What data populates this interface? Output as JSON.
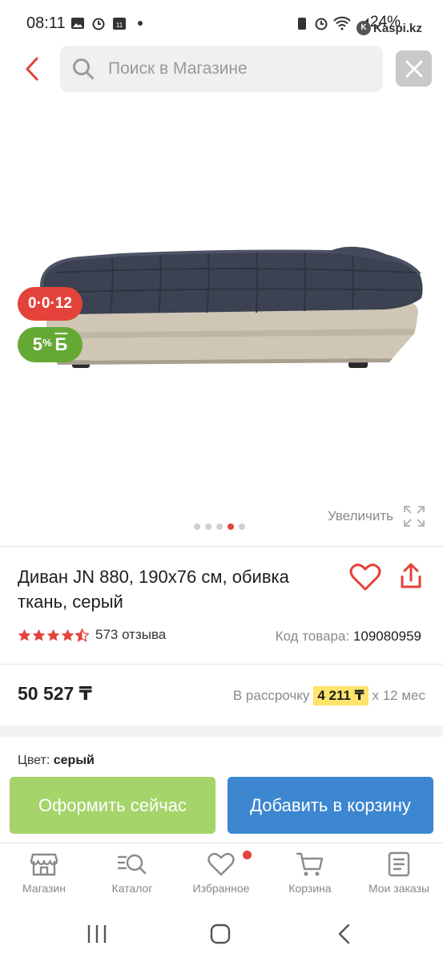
{
  "status_bar": {
    "time": "08:11",
    "battery": "24%",
    "watermark": "Kaspi.kz",
    "icons_left": [
      "gallery-icon",
      "alarm-icon",
      "calendar-icon",
      "dot-icon"
    ],
    "icons_right": [
      "battery-saver-icon",
      "alarm-icon",
      "wifi-icon",
      "signal-icon"
    ]
  },
  "search": {
    "placeholder": "Поиск в Магазине"
  },
  "gallery": {
    "badge_installment": "0·0·12",
    "badge_bonus_percent": "5",
    "badge_bonus_suffix": "%",
    "badge_bonus_currency": "Б",
    "zoom_label": "Увеличить",
    "image_count": 5,
    "active_image_index": 3
  },
  "product": {
    "title": "Диван JN 880, 190x76 см, обивка ткань, серый",
    "rating": 4.5,
    "reviews": "573 отзыва",
    "sku_label": "Код товара:",
    "sku_value": "109080959"
  },
  "price": {
    "value": "50 527 ₸",
    "installment_label": "В рассрочку",
    "installment_amount": "4 211 ₸",
    "installment_term": "x 12 мес"
  },
  "color": {
    "label": "Цвет:",
    "value": "серый"
  },
  "actions": {
    "buy_now": "Оформить сейчас",
    "add_to_cart": "Добавить в корзину"
  },
  "bottom_nav": {
    "items": [
      {
        "label": "Магазин",
        "icon": "store-icon"
      },
      {
        "label": "Каталог",
        "icon": "catalog-search-icon"
      },
      {
        "label": "Избранное",
        "icon": "heart-icon"
      },
      {
        "label": "Корзина",
        "icon": "cart-icon"
      },
      {
        "label": "Мои заказы",
        "icon": "orders-icon"
      }
    ]
  },
  "colors": {
    "accent_red": "#e3433a",
    "green_button": "#a5d46a",
    "blue_button": "#3d86d0",
    "bonus_green": "#65a935",
    "highlight_yellow": "#ffe36a"
  }
}
